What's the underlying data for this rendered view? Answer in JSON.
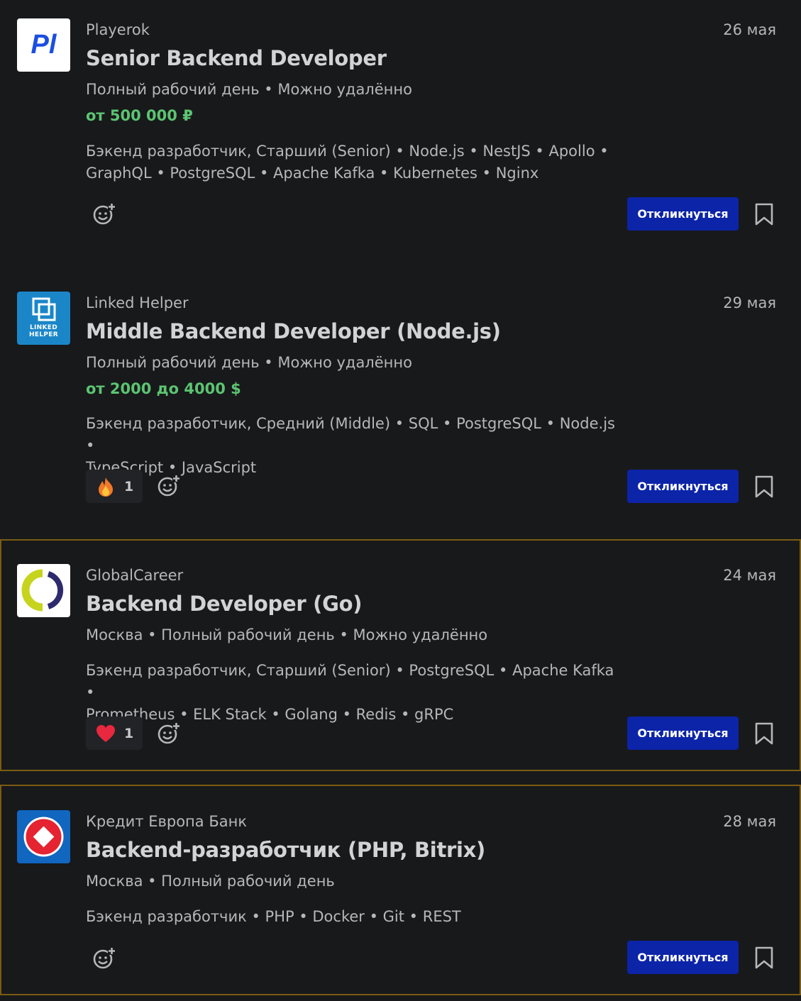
{
  "vacancies": [
    {
      "company": "Playerok",
      "date": "26 мая",
      "title": "Senior Backend Developer",
      "meta": "Полный рабочий день • Можно удалённо",
      "salary": "от 500 000 ₽",
      "skills_line1": "Бэкенд разработчик, Старший (Senior) • Node.js • NestJS • Apollo •",
      "skills_line2": "GraphQL • PostgreSQL • Apache Kafka • Kubernetes • Nginx",
      "apply_label": "Откликнуться",
      "logo_text": "Pl",
      "reaction": null
    },
    {
      "company": "Linked Helper",
      "date": "29 мая",
      "title": "Middle Backend Developer (Node.js)",
      "meta": "Полный рабочий день • Можно удалённо",
      "salary": "от 2000 до 4000 $",
      "skills_line1": "Бэкенд разработчик, Средний (Middle) • SQL • PostgreSQL • Node.js •",
      "skills_line2": "TypeScript • JavaScript",
      "apply_label": "Откликнуться",
      "logo_text_1": "LINKED",
      "logo_text_2": "HELPER",
      "reaction": {
        "icon": "fire-icon",
        "count": "1"
      }
    },
    {
      "company": "GlobalCareer",
      "date": "24 мая",
      "title": "Backend Developer (Go)",
      "meta": "Москва • Полный рабочий день • Можно удалённо",
      "skills_line1": "Бэкенд разработчик, Старший (Senior) • PostgreSQL • Apache Kafka •",
      "skills_line2": "Prometheus • ELK Stack • Golang • Redis • gRPC",
      "apply_label": "Откликнуться",
      "reaction": {
        "icon": "heart-icon",
        "count": "1"
      }
    },
    {
      "company": "Кредит Европа Банк",
      "date": "28 мая",
      "title": "Backend-разработчик (PHP, Bitrix)",
      "meta": "Москва • Полный рабочий день",
      "skills_line1": "Бэкенд разработчик • PHP • Docker • Git • REST",
      "apply_label": "Откликнуться",
      "reaction": null
    }
  ],
  "colors": {
    "background": "#18191b",
    "salary": "#5cc472",
    "apply_button": "#0c24a8",
    "highlight_border": "#7a5c12"
  }
}
